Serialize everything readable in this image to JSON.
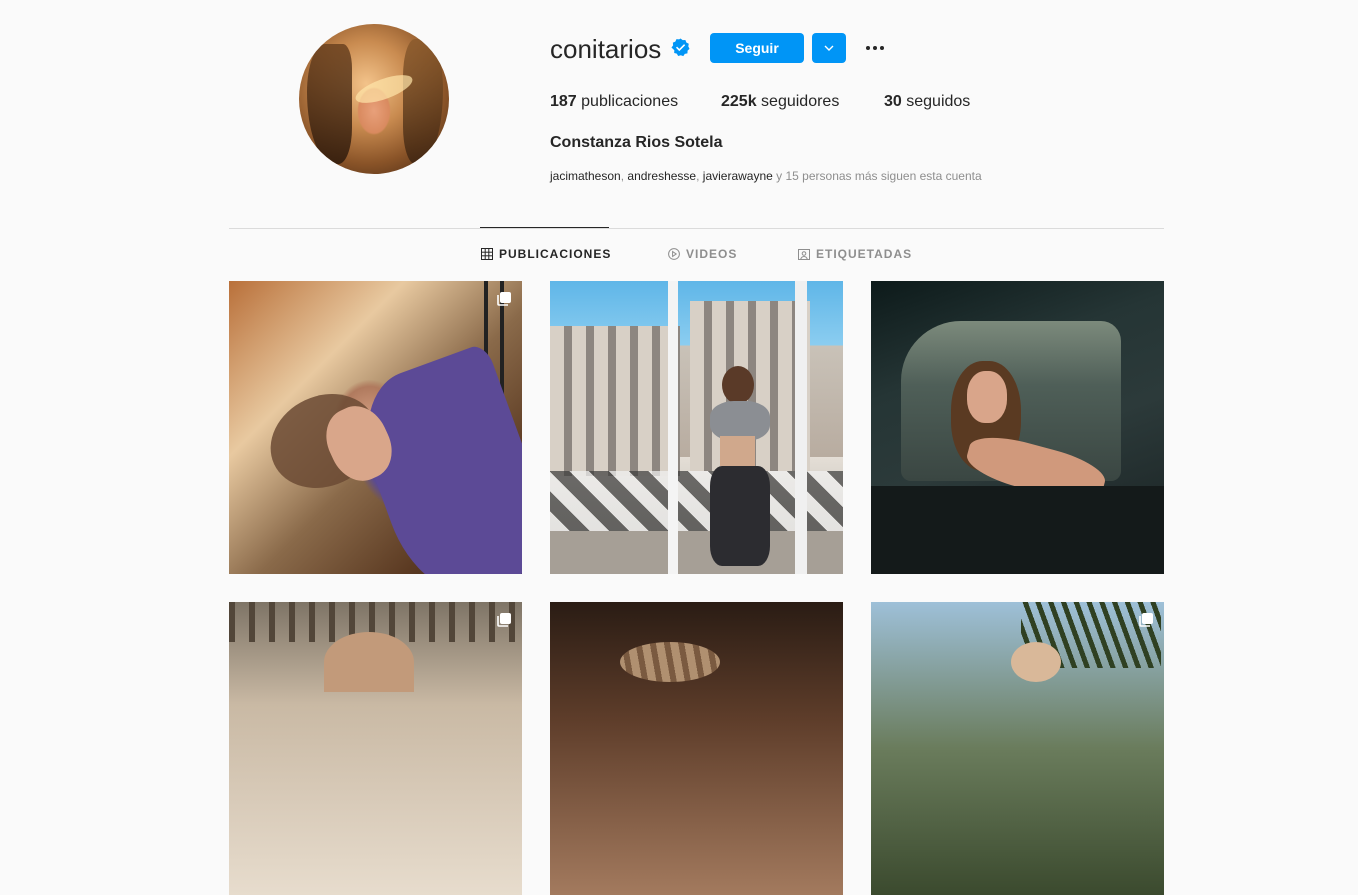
{
  "profile": {
    "username": "conitarios",
    "follow_label": "Seguir",
    "stats": {
      "posts_count": "187",
      "posts_label": " publicaciones",
      "followers_count": "225k",
      "followers_label": " seguidores",
      "following_count": "30",
      "following_label": " seguidos"
    },
    "full_name": "Constanza Rios Sotela",
    "followed_by": {
      "users": [
        "jacimatheson",
        "andreshesse",
        "javierawayne"
      ],
      "separator": ", ",
      "suffix": " y 15 personas más siguen esta cuenta"
    }
  },
  "tabs": [
    {
      "label": "PUBLICACIONES",
      "icon": "grid-icon",
      "active": true
    },
    {
      "label": "VIDEOS",
      "icon": "play-icon",
      "active": false
    },
    {
      "label": "ETIQUETADAS",
      "icon": "tagged-icon",
      "active": false
    }
  ],
  "posts": [
    {
      "multi": true
    },
    {
      "multi": false
    },
    {
      "multi": false
    },
    {
      "multi": true
    },
    {
      "multi": false
    },
    {
      "multi": true
    }
  ],
  "colors": {
    "accent": "#0095f6",
    "text": "#262626",
    "muted": "#8e8e8e",
    "background": "#fafafa",
    "divider": "#dbdbdb"
  }
}
